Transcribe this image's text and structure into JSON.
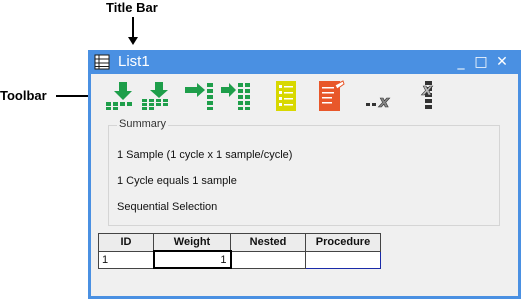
{
  "annotations": {
    "title_bar": "Title Bar",
    "toolbar": "Toolbar"
  },
  "window": {
    "title": "List1",
    "minimize": "_",
    "maximize": "□",
    "close": "✕"
  },
  "toolbar": {
    "icons": [
      "import-down-icon",
      "import-append-icon",
      "move-right-icon",
      "transfer-icon",
      "checklist-icon",
      "edit-sheet-icon",
      "clear-x-icon",
      "delete-column-icon"
    ]
  },
  "summary": {
    "legend": "Summary",
    "line1": "1 Sample (1 cycle x 1 sample/cycle)",
    "line2": "1 Cycle equals 1 sample",
    "line3": "Sequential Selection"
  },
  "grid": {
    "headers": [
      "ID",
      "Weight",
      "Nested",
      "Procedure"
    ],
    "rows": [
      [
        "1",
        "1",
        "",
        ""
      ]
    ]
  },
  "colors": {
    "window_frame": "#4a90e2",
    "client_bg": "#f0f0f0",
    "icon_green": "#1e9e4a",
    "icon_yellow": "#d8d800",
    "icon_orange": "#e8572a"
  }
}
